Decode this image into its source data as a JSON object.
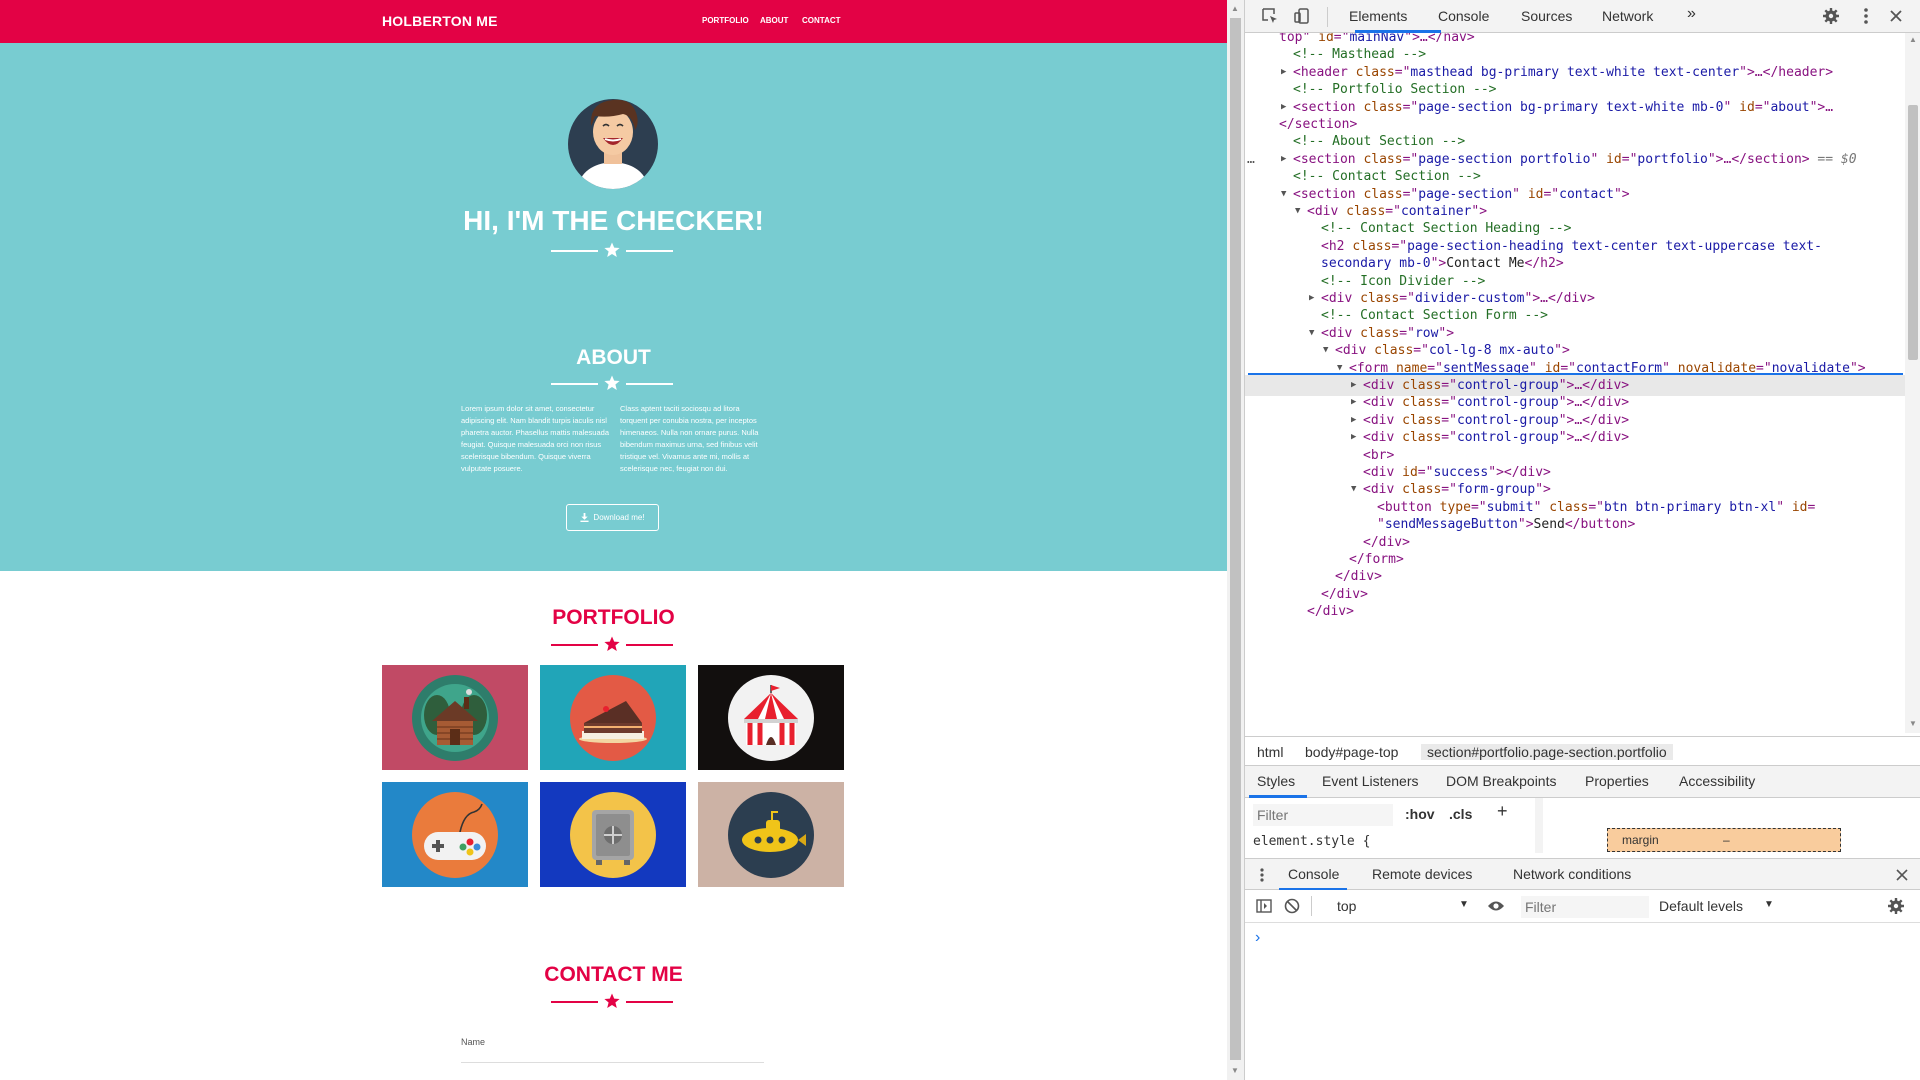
{
  "page": {
    "brand": "HOLBERTON ME",
    "nav": [
      "PORTFOLIO",
      "ABOUT",
      "CONTACT"
    ],
    "hero_title": "HI, I'M THE CHECKER!",
    "about": {
      "title": "ABOUT",
      "col1": "Lorem ipsum dolor sit amet, consectetur adipiscing elit. Nam blandit turpis iaculis nisl pharetra auctor. Phasellus mattis malesuada feugiat. Quisque malesuada orci non risus scelerisque bibendum. Quisque viverra vulputate posuere.",
      "col2": "Class aptent taciti sociosqu ad litora torquent per conubia nostra, per inceptos himenaeos. Nulla non ornare purus. Nulla bibendum maximus urna, sed finibus velit tristique vel. Vivamus ante mi, mollis at scelerisque nec, feugiat non dui.",
      "download_label": "Download me!"
    },
    "portfolio": {
      "title": "PORTFOLIO",
      "tiles": [
        {
          "icon": "cabin-icon",
          "bg": "#c14a65"
        },
        {
          "icon": "cake-icon",
          "bg": "#21a5b8"
        },
        {
          "icon": "circus-tent-icon",
          "bg": "#120f0e"
        },
        {
          "icon": "game-controller-icon",
          "bg": "#2388c8"
        },
        {
          "icon": "safe-icon",
          "bg": "#1339bf"
        },
        {
          "icon": "submarine-icon",
          "bg": "#ccb2a5"
        }
      ]
    },
    "contact": {
      "title": "CONTACT ME",
      "name_label": "Name"
    },
    "colors": {
      "primary": "#e30245",
      "teal": "#78ccd1"
    }
  },
  "devtools": {
    "tabs": [
      "Elements",
      "Console",
      "Sources",
      "Network"
    ],
    "more_tabs": "»",
    "dom_lines": [
      {
        "segments": [
          [
            "tg",
            "top\" "
          ],
          [
            "an",
            "id"
          ],
          [
            "tg",
            "=\""
          ],
          [
            "av",
            "mainNav"
          ],
          [
            "tg",
            "\">…</nav>"
          ]
        ]
      },
      {
        "segments": [
          [
            "cm",
            "<!-- Masthead -->"
          ]
        ]
      },
      {
        "segments": [
          [
            "tg",
            "<header "
          ],
          [
            "an",
            "class"
          ],
          [
            "tg",
            "=\""
          ],
          [
            "av",
            "masthead bg-primary text-white text-center"
          ],
          [
            "tg",
            "\">…</header>"
          ]
        ]
      },
      {
        "segments": [
          [
            "cm",
            "<!-- Portfolio Section -->"
          ]
        ]
      },
      {
        "segments": [
          [
            "tg",
            "<section "
          ],
          [
            "an",
            "class"
          ],
          [
            "tg",
            "=\""
          ],
          [
            "av",
            "page-section bg-primary text-white mb-0"
          ],
          [
            "tg",
            "\" "
          ],
          [
            "an",
            "id"
          ],
          [
            "tg",
            "=\""
          ],
          [
            "av",
            "about"
          ],
          [
            "tg",
            "\">…"
          ]
        ]
      },
      {
        "segments": [
          [
            "tg",
            "</section>"
          ]
        ]
      },
      {
        "segments": [
          [
            "cm",
            "<!-- About Section -->"
          ]
        ]
      },
      {
        "segments": [
          [
            "tg",
            "<section "
          ],
          [
            "an",
            "class"
          ],
          [
            "tg",
            "=\""
          ],
          [
            "av",
            "page-section portfolio"
          ],
          [
            "tg",
            "\" "
          ],
          [
            "an",
            "id"
          ],
          [
            "tg",
            "=\""
          ],
          [
            "av",
            "portfolio"
          ],
          [
            "tg",
            "\">…</section>"
          ],
          [
            "tx",
            " == $0"
          ]
        ]
      },
      {
        "segments": [
          [
            "cm",
            "<!-- Contact Section -->"
          ]
        ]
      },
      {
        "segments": [
          [
            "tg",
            "<section "
          ],
          [
            "an",
            "class"
          ],
          [
            "tg",
            "=\""
          ],
          [
            "av",
            "page-section"
          ],
          [
            "tg",
            "\" "
          ],
          [
            "an",
            "id"
          ],
          [
            "tg",
            "=\""
          ],
          [
            "av",
            "contact"
          ],
          [
            "tg",
            "\">"
          ]
        ]
      },
      {
        "segments": [
          [
            "tg",
            "<div "
          ],
          [
            "an",
            "class"
          ],
          [
            "tg",
            "=\""
          ],
          [
            "av",
            "container"
          ],
          [
            "tg",
            "\">"
          ]
        ]
      },
      {
        "segments": [
          [
            "cm",
            "<!-- Contact Section Heading -->"
          ]
        ]
      },
      {
        "segments": [
          [
            "tg",
            "<h2 "
          ],
          [
            "an",
            "class"
          ],
          [
            "tg",
            "=\""
          ],
          [
            "av",
            "page-section-heading text-center text-uppercase text-"
          ]
        ]
      },
      {
        "segments": [
          [
            "av",
            "secondary mb-0"
          ],
          [
            "tg",
            "\">"
          ],
          [
            "tx",
            "Contact Me"
          ],
          [
            "tg",
            "</h2>"
          ]
        ]
      },
      {
        "segments": [
          [
            "cm",
            "<!-- Icon Divider -->"
          ]
        ]
      },
      {
        "segments": [
          [
            "tg",
            "<div "
          ],
          [
            "an",
            "class"
          ],
          [
            "tg",
            "=\""
          ],
          [
            "av",
            "divider-custom"
          ],
          [
            "tg",
            "\">…</div>"
          ]
        ]
      },
      {
        "segments": [
          [
            "cm",
            "<!-- Contact Section Form -->"
          ]
        ]
      },
      {
        "segments": [
          [
            "tg",
            "<div "
          ],
          [
            "an",
            "class"
          ],
          [
            "tg",
            "=\""
          ],
          [
            "av",
            "row"
          ],
          [
            "tg",
            "\">"
          ]
        ]
      },
      {
        "segments": [
          [
            "tg",
            "<div "
          ],
          [
            "an",
            "class"
          ],
          [
            "tg",
            "=\""
          ],
          [
            "av",
            "col-lg-8 mx-auto"
          ],
          [
            "tg",
            "\">"
          ]
        ]
      },
      {
        "segments": [
          [
            "tg",
            "<form "
          ],
          [
            "an",
            "name"
          ],
          [
            "tg",
            "=\""
          ],
          [
            "av",
            "sentMessage"
          ],
          [
            "tg",
            "\" "
          ],
          [
            "an",
            "id"
          ],
          [
            "tg",
            "=\""
          ],
          [
            "av",
            "contactForm"
          ],
          [
            "tg",
            "\" "
          ],
          [
            "an",
            "novalidate"
          ],
          [
            "tg",
            "=\""
          ],
          [
            "av",
            "novalidate"
          ],
          [
            "tg",
            "\">"
          ]
        ]
      },
      {
        "segments": [
          [
            "tg",
            "<div "
          ],
          [
            "an",
            "class"
          ],
          [
            "tg",
            "=\""
          ],
          [
            "av",
            "control-group"
          ],
          [
            "tg",
            "\">…</div>"
          ]
        ]
      },
      {
        "segments": [
          [
            "tg",
            "<div "
          ],
          [
            "an",
            "class"
          ],
          [
            "tg",
            "=\""
          ],
          [
            "av",
            "control-group"
          ],
          [
            "tg",
            "\">…</div>"
          ]
        ]
      },
      {
        "segments": [
          [
            "tg",
            "<div "
          ],
          [
            "an",
            "class"
          ],
          [
            "tg",
            "=\""
          ],
          [
            "av",
            "control-group"
          ],
          [
            "tg",
            "\">…</div>"
          ]
        ]
      },
      {
        "segments": [
          [
            "tg",
            "<div "
          ],
          [
            "an",
            "class"
          ],
          [
            "tg",
            "=\""
          ],
          [
            "av",
            "control-group"
          ],
          [
            "tg",
            "\">…</div>"
          ]
        ]
      },
      {
        "segments": [
          [
            "tg",
            "<br>"
          ]
        ]
      },
      {
        "segments": [
          [
            "tg",
            "<div "
          ],
          [
            "an",
            "id"
          ],
          [
            "tg",
            "=\""
          ],
          [
            "av",
            "success"
          ],
          [
            "tg",
            "\"></div>"
          ]
        ]
      },
      {
        "segments": [
          [
            "tg",
            "<div "
          ],
          [
            "an",
            "class"
          ],
          [
            "tg",
            "=\""
          ],
          [
            "av",
            "form-group"
          ],
          [
            "tg",
            "\">"
          ]
        ]
      },
      {
        "segments": [
          [
            "tg",
            "<button "
          ],
          [
            "an",
            "type"
          ],
          [
            "tg",
            "=\""
          ],
          [
            "av",
            "submit"
          ],
          [
            "tg",
            "\" "
          ],
          [
            "an",
            "class"
          ],
          [
            "tg",
            "=\""
          ],
          [
            "av",
            "btn btn-primary btn-xl"
          ],
          [
            "tg",
            "\" "
          ],
          [
            "an",
            "id"
          ],
          [
            "tg",
            "="
          ]
        ]
      },
      {
        "segments": [
          [
            "tg",
            "\""
          ],
          [
            "av",
            "sendMessageButton"
          ],
          [
            "tg",
            "\">"
          ],
          [
            "tx",
            "Send"
          ],
          [
            "tg",
            "</button>"
          ]
        ]
      },
      {
        "segments": [
          [
            "tg",
            "</div>"
          ]
        ]
      },
      {
        "segments": [
          [
            "tg",
            "</form>"
          ]
        ]
      },
      {
        "segments": [
          [
            "tg",
            "</div>"
          ]
        ]
      },
      {
        "segments": [
          [
            "tg",
            "</div>"
          ]
        ]
      },
      {
        "segments": [
          [
            "tg",
            "</div>"
          ]
        ]
      }
    ],
    "breadcrumb": [
      "html",
      "body#page-top",
      "section#portfolio.page-section.portfolio"
    ],
    "styles_tabs": [
      "Styles",
      "Event Listeners",
      "DOM Breakpoints",
      "Properties",
      "Accessibility"
    ],
    "filter_placeholder": "Filter",
    "hov": ":hov",
    "cls": ".cls",
    "element_style": "element.style {",
    "boxmodel_label": "margin",
    "boxmodel_value": "–",
    "drawer_tabs": [
      "Console",
      "Remote devices",
      "Network conditions"
    ],
    "console_context": "top",
    "console_filter_placeholder": "Filter",
    "levels": "Default levels",
    "prompt": "›"
  }
}
